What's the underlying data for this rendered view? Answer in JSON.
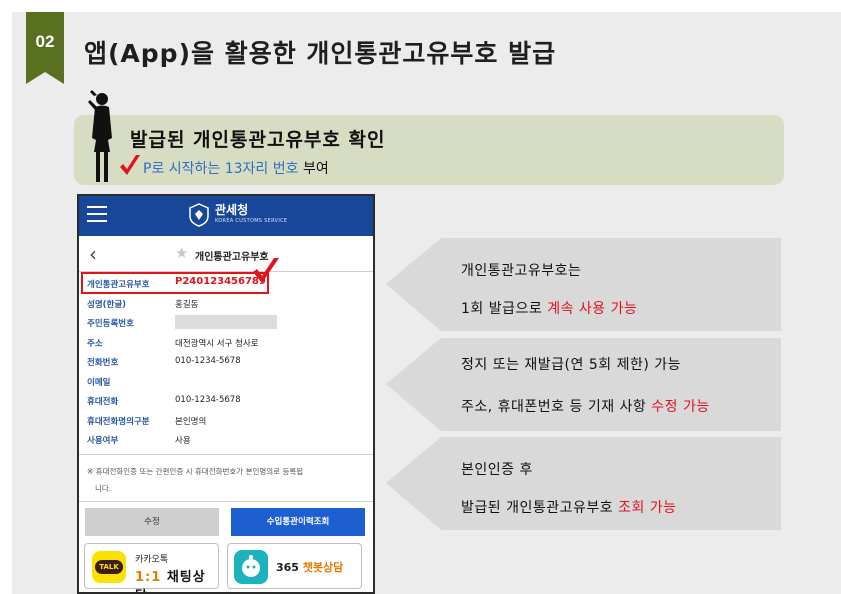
{
  "slide": {
    "number": "02",
    "title": "앱(App)을 활용한 개인통관고유부호 발급"
  },
  "banner": {
    "main": "발급된 개인통관고유부호 확인",
    "sub_highlight": "P로 시작하는 13자리 번호",
    "sub_rest": " 부여"
  },
  "app": {
    "header_name": "관세청",
    "header_sub": "KOREA CUSTOMS SERVICE",
    "nav_back_icon": "chevron-left-icon",
    "nav_title": "개인통관고유부호",
    "rows": [
      {
        "label": "개인통관고유부호",
        "value": "P240123456789"
      },
      {
        "label": "성명(한글)",
        "value": "홍길동"
      },
      {
        "label": "주민등록번호",
        "value": ""
      },
      {
        "label": "주소",
        "value": "대전광역시 서구 청사로"
      },
      {
        "label": "전화번호",
        "value": "010-1234-5678"
      },
      {
        "label": "이메일",
        "value": ""
      },
      {
        "label": "휴대전화",
        "value": "010-1234-5678"
      },
      {
        "label": "휴대전화명의구분",
        "value": "본인명의"
      },
      {
        "label": "사용여부",
        "value": "사용"
      }
    ],
    "note_line1": "※ 휴대전화인증 또는 간편인증 시 휴대전화번호가 본인명의로 등록됩",
    "note_line2": "니다.",
    "btn_edit": "수정",
    "btn_history": "수입통관이력조회",
    "kakao_talk_label": "TALK",
    "kakao_line1": "카카오톡",
    "kakao_line2_prefix": "1:1 ",
    "kakao_line2_rest": "채팅상담",
    "bot_prefix": "365 ",
    "bot_rest": "챗봇상담"
  },
  "callouts": [
    {
      "line1": "개인통관고유부호는",
      "line2_a": "1회 발급으로 ",
      "line2_red": "계속 사용 가능",
      "line2_b": ""
    },
    {
      "line1": "정지 또는 재발급(연 5회 제한) 가능",
      "line2_a": "주소, 휴대폰번호 등 기재 사항 ",
      "line2_red": "수정 가능",
      "line2_b": ""
    },
    {
      "line1": "본인인증 후",
      "line2_a": "발급된 개인통관고유부호 ",
      "line2_red": "조회 가능",
      "line2_b": ""
    }
  ],
  "colors": {
    "badge": "#58701f",
    "banner_bg": "#d7ddc2",
    "accent_red": "#e0141e",
    "app_blue": "#18479a"
  }
}
